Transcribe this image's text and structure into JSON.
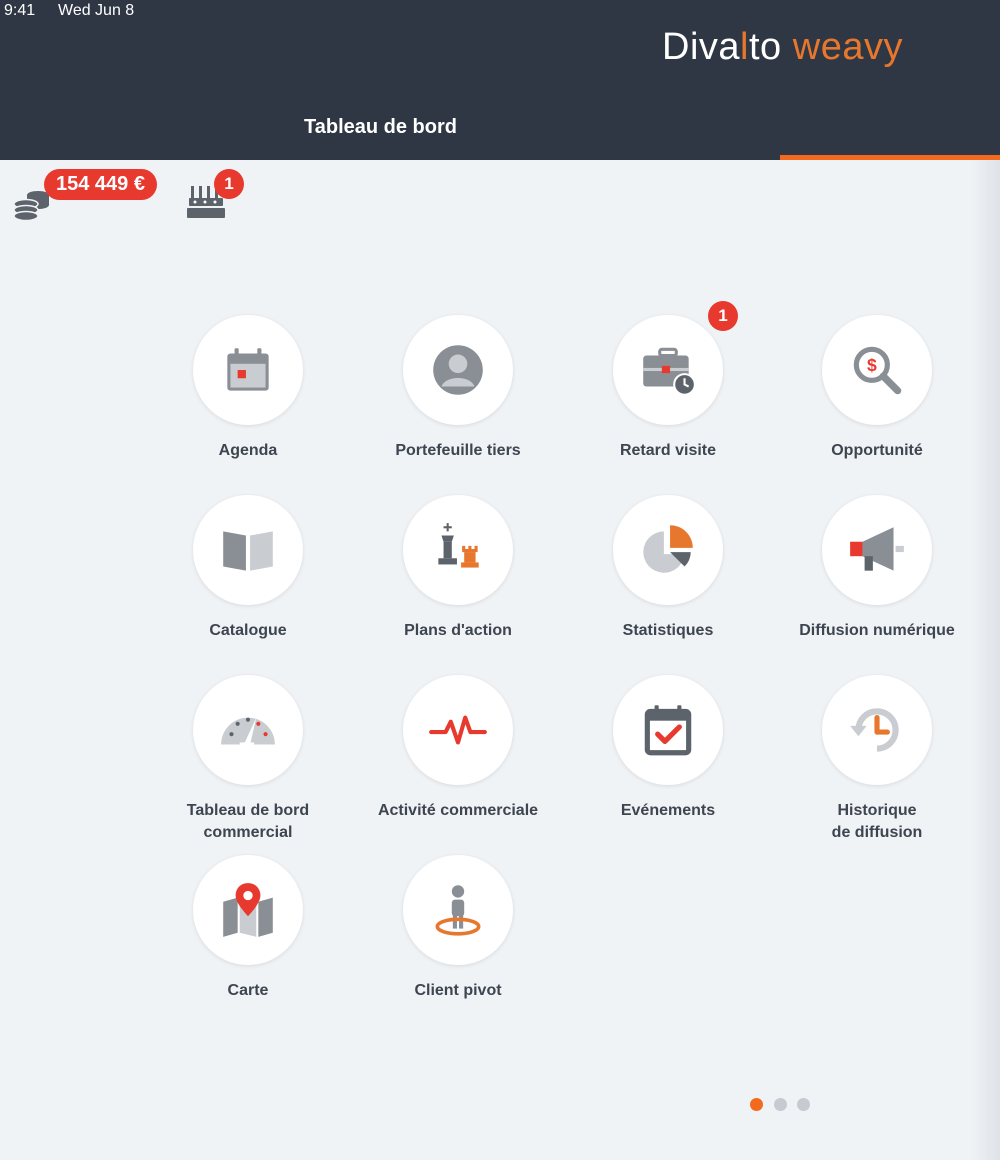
{
  "status_bar": {
    "time": "9:41",
    "date": "Wed Jun 8"
  },
  "brand": {
    "part1": "Diva",
    "part2": "l",
    "part3": "to",
    "part4": "weavy"
  },
  "tabs": [
    {
      "label": "Tableau de bord",
      "active": true
    }
  ],
  "stats": {
    "revenue_badge": "154 449 €",
    "revenue_icon": "coins-icon",
    "birthday_badge": "1",
    "birthday_icon": "cake-icon"
  },
  "tiles": [
    {
      "label": "Agenda",
      "icon": "calendar-icon"
    },
    {
      "label": "Portefeuille tiers",
      "icon": "user-icon"
    },
    {
      "label": "Retard visite",
      "icon": "briefcase-clock-icon",
      "badge": "1"
    },
    {
      "label": "Opportunité",
      "icon": "dollar-search-icon"
    },
    {
      "label": "Catalogue",
      "icon": "book-icon"
    },
    {
      "label": "Plans d'action",
      "icon": "chess-icon"
    },
    {
      "label": "Statistiques",
      "icon": "pie-chart-icon"
    },
    {
      "label": "Diffusion numérique",
      "icon": "megaphone-icon"
    },
    {
      "label_line1": "Tableau de bord",
      "label_line2": "commercial",
      "icon": "gauge-icon"
    },
    {
      "label": "Activité commerciale",
      "icon": "pulse-icon"
    },
    {
      "label": "Evénements",
      "icon": "calendar-check-icon"
    },
    {
      "label_line1": "Historique",
      "label_line2": "de diffusion",
      "icon": "history-icon"
    },
    {
      "label": "Carte",
      "icon": "map-pin-icon"
    },
    {
      "label": "Client pivot",
      "icon": "person-pivot-icon"
    }
  ],
  "pagination": {
    "pages": 3,
    "current": 1
  },
  "colors": {
    "accent": "#f26b1d",
    "badge": "#e8392f",
    "header": "#2e3743",
    "icon_gray": "#8a8f96"
  }
}
